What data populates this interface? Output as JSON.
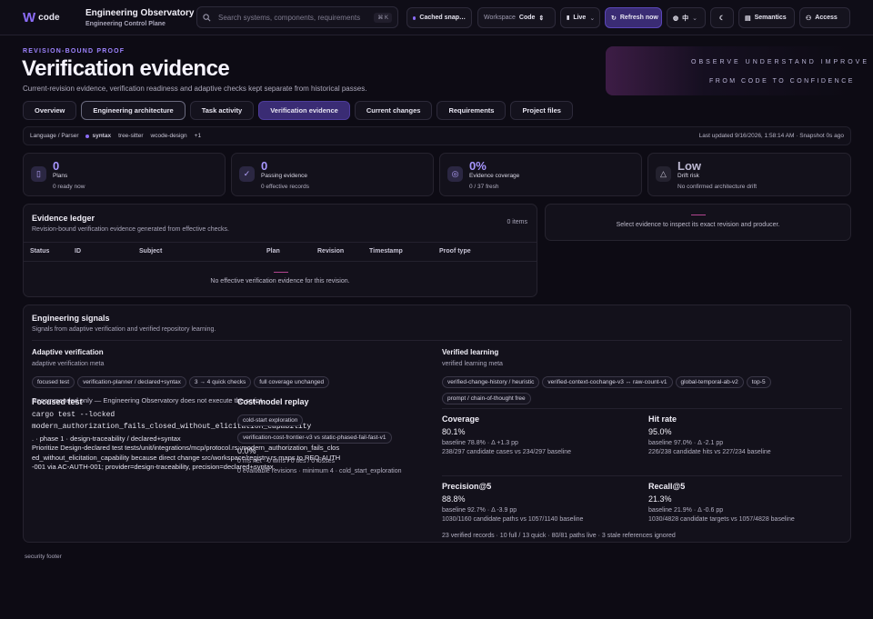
{
  "header": {
    "logo_text": "code",
    "app_title": "Engineering Observatory",
    "app_subtitle": "Engineering Control Plane",
    "search_placeholder": "Search systems, components, requirements",
    "search_shortcut": "⌘ K",
    "cached": "Cached snap…",
    "workspace_label": "Workspace",
    "workspace_value": "Code",
    "live": "Live",
    "refresh": "Refresh now",
    "lang": "中",
    "semantics": "Semantics",
    "access": "Access"
  },
  "hero": {
    "kicker": "REVISION-BOUND PROOF",
    "title": "Verification evidence",
    "subtitle": "Current-revision evidence, verification readiness and adaptive checks kept separate from historical passes.",
    "tagline1": "OBSERVE  UNDERSTAND  IMPROVE",
    "tagline2": "FROM CODE TO CONFIDENCE"
  },
  "tabs": [
    "Overview",
    "Engineering architecture",
    "Task activity",
    "Verification evidence",
    "Current changes",
    "Requirements",
    "Project files"
  ],
  "context": {
    "label": "Language / Parser",
    "parser": "syntax",
    "p2": "tree-sitter",
    "p3": "wcode-design",
    "more": "+1",
    "updated": "Last updated 9/16/2026, 1:58:14 AM · Snapshot 0s ago"
  },
  "stats": [
    {
      "value": "0",
      "label": "Plans",
      "detail": "0 ready now",
      "icon": "doc-icon"
    },
    {
      "value": "0",
      "label": "Passing evidence",
      "detail": "0 effective records",
      "icon": "check-icon"
    },
    {
      "value": "0%",
      "label": "Evidence coverage",
      "detail": "0 / 37 fresh",
      "icon": "target-icon"
    },
    {
      "value": "Low",
      "label": "Drift risk",
      "detail": "No confirmed architecture drift",
      "icon": "warning-icon"
    }
  ],
  "ledger": {
    "title": "Evidence ledger",
    "subtitle": "Revision-bound verification evidence generated from effective checks.",
    "count": "0 items",
    "columns": [
      "Status",
      "ID",
      "Subject",
      "Plan",
      "Revision",
      "Timestamp",
      "Proof type"
    ],
    "empty": "No effective verification evidence for this revision."
  },
  "inspect": {
    "text": "Select evidence to inspect its exact revision and producer."
  },
  "signals": {
    "title": "Engineering signals",
    "subtitle": "Signals from adaptive verification and verified repository learning.",
    "adaptive": {
      "title": "Adaptive verification",
      "meta": "adaptive verification meta",
      "chips": [
        "focused test",
        "verification-planner / declared+syntax",
        "3 → 4 quick checks",
        "full coverage unchanged"
      ]
    },
    "overlap_note": "Recommended only — Engineering Observatory does not execute the script.",
    "focused": {
      "title": "Focused test",
      "cmd1": "cargo test --locked",
      "cmd2": "modern_authorization_fails_closed_without_elicitation_capability",
      "meta": ". · phase 1 · design-traceability / declared+syntax",
      "desc": "Prioritize Design-declared test tests/unit/integrations/mcp/protocol.rs::modern_authorization_fails_closed_without_elicitation_capability because direct change src/workspace/registry.rs maps to REQ-AUTH-001 via AC-AUTH-001; provider=design-traceability, precision=declared+syntax."
    },
    "cost": {
      "title": "Cost-model replay",
      "chip1": "cold-start exploration",
      "chip2": "verification-cost-frontier-v3 vs static-phased-fail-fast-v1",
      "pct": "0.0%",
      "l1": "0 ms net · 0 wins / 0 ties / 0 losses",
      "l2": "0 evaluable revisions · minimum 4 · cold_start_exploration"
    },
    "verified": {
      "title": "Verified learning",
      "meta": "verified learning meta",
      "chips": [
        "verified-change-history / heuristic",
        "verified-context-cochange-v3 ↔ raw-count-v1",
        "global-temporal-ab-v2",
        "top-5",
        "prompt / chain-of-thought free"
      ]
    },
    "metrics": [
      {
        "name": "Coverage",
        "value": "80.1%",
        "base": "baseline 78.8% · Δ +1.3 pp",
        "detail": "238/297 candidate cases vs 234/297 baseline"
      },
      {
        "name": "Hit rate",
        "value": "95.0%",
        "base": "baseline 97.0% · Δ -2.1 pp",
        "detail": "226/238 candidate hits vs 227/234 baseline"
      },
      {
        "name": "Precision@5",
        "value": "88.8%",
        "base": "baseline 92.7% · Δ -3.9 pp",
        "detail": "1030/1160 candidate paths vs 1057/1140 baseline"
      },
      {
        "name": "Recall@5",
        "value": "21.3%",
        "base": "baseline 21.9% · Δ -0.6 pp",
        "detail": "1030/4828 candidate targets vs 1057/4828 baseline"
      }
    ],
    "footer": "23 verified records · 10 full / 13 quick · 80/81 paths live · 3 stale references ignored"
  },
  "footer": "security footer"
}
